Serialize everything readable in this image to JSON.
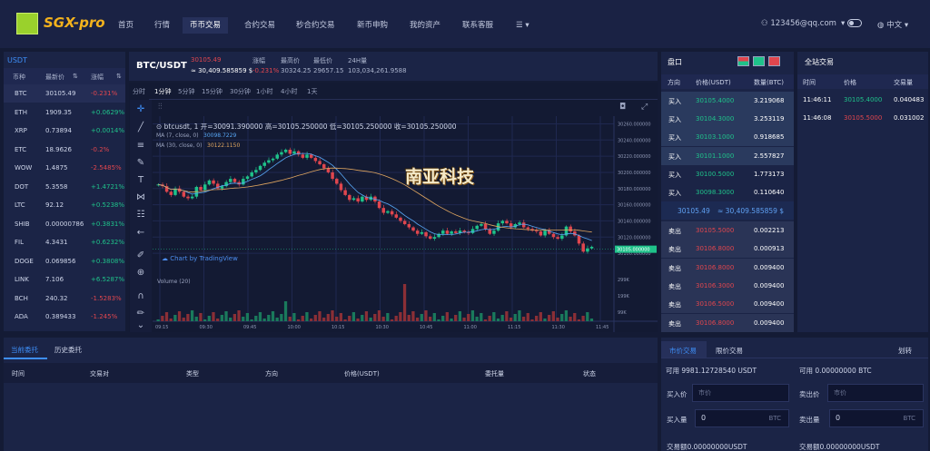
{
  "nav": {
    "logo_text": "SGX-pro",
    "items": [
      "首页",
      "行情",
      "币币交易",
      "合约交易",
      "秒合约交易",
      "新币申购",
      "我的资产",
      "联系客服",
      "☰ ▾"
    ],
    "active_index": 2,
    "user": "123456@qq.com",
    "lang": "中文"
  },
  "pairs": {
    "group": "USDT",
    "headers": [
      "币种",
      "最新价",
      "涨幅"
    ],
    "rows": [
      {
        "sym": "BTC",
        "price": "30105.49",
        "chg": "-0.231%",
        "dir": "down"
      },
      {
        "sym": "ETH",
        "price": "1909.35",
        "chg": "+0.0629%",
        "dir": "up"
      },
      {
        "sym": "XRP",
        "price": "0.73894",
        "chg": "+0.0014%",
        "dir": "up"
      },
      {
        "sym": "ETC",
        "price": "18.9626",
        "chg": "-0.2%",
        "dir": "down"
      },
      {
        "sym": "WOW",
        "price": "1.4875",
        "chg": "-2.5485%",
        "dir": "down"
      },
      {
        "sym": "DOT",
        "price": "5.3558",
        "chg": "+1.4721%",
        "dir": "up"
      },
      {
        "sym": "LTC",
        "price": "92.12",
        "chg": "+0.5238%",
        "dir": "up"
      },
      {
        "sym": "SHIB",
        "price": "0.00000786",
        "chg": "+0.3831%",
        "dir": "up"
      },
      {
        "sym": "FIL",
        "price": "4.3431",
        "chg": "+0.6232%",
        "dir": "up"
      },
      {
        "sym": "DOGE",
        "price": "0.069856",
        "chg": "+0.3808%",
        "dir": "up"
      },
      {
        "sym": "LINK",
        "price": "7.106",
        "chg": "+6.5287%",
        "dir": "up"
      },
      {
        "sym": "BCH",
        "price": "240.32",
        "chg": "-1.5283%",
        "dir": "down"
      },
      {
        "sym": "ADA",
        "price": "0.389433",
        "chg": "-1.245%",
        "dir": "down"
      }
    ]
  },
  "ticker": {
    "pair": "BTC/USDT",
    "price": "30105.49",
    "cny": "≈ 30,409.585859 $",
    "chg_label": "涨幅",
    "chg": "-0.231%",
    "high_label": "最高价",
    "high": "30324.25",
    "low_label": "最低价",
    "low": "29657.15",
    "vol_label": "24H量",
    "vol": "103,034,261.9588"
  },
  "chart": {
    "intervals": [
      "分时",
      "1分钟",
      "5分钟",
      "15分钟",
      "30分钟",
      "1小时",
      "4小时",
      "1天"
    ],
    "active_interval": 1,
    "ohlc_line": "btcusdt, 1  开=30091.390000  高=30105.250000  低=30105.250000  收=30105.250000",
    "ma7": "MA (7, close, 0)",
    "ma7_val": "30098.7229",
    "ma30": "MA (30, close, 0)",
    "ma30_val": "30122.1150",
    "volume_label": "Volume (20)",
    "brand": "Chart by TradingView",
    "watermark": "南亚科技",
    "y_ticks": [
      "30260.000000",
      "30240.000000",
      "30220.000000",
      "30200.000000",
      "30180.000000",
      "30160.000000",
      "30140.000000",
      "30120.000000",
      "30100.000000"
    ],
    "current_price": "30105.000000",
    "vol_ticks": [
      "299K",
      "199K",
      "99K"
    ],
    "x_ticks": [
      "09:15",
      "09:30",
      "09:45",
      "10:00",
      "10:15",
      "10:30",
      "10:45",
      "11:00",
      "11:15",
      "11:30",
      "11:45"
    ]
  },
  "chart_data": {
    "type": "candlestick",
    "y_range": [
      30090,
      30265
    ],
    "closes": [
      30185,
      30183,
      30176,
      30172,
      30180,
      30176,
      30170,
      30168,
      30170,
      30182,
      30178,
      30185,
      30190,
      30186,
      30180,
      30183,
      30188,
      30192,
      30188,
      30185,
      30192,
      30195,
      30200,
      30203,
      30208,
      30212,
      30215,
      30217,
      30222,
      30225,
      30228,
      30223,
      30226,
      30222,
      30218,
      30222,
      30218,
      30214,
      30210,
      30205,
      30200,
      30192,
      30186,
      30178,
      30172,
      30166,
      30168,
      30164,
      30170,
      30166,
      30170,
      30164,
      30156,
      30150,
      30152,
      30148,
      30144,
      30140,
      30136,
      30132,
      30128,
      30124,
      30126,
      30121,
      30118,
      30120,
      30124,
      30128,
      30124,
      30127,
      30125,
      30128,
      30126,
      30125,
      30130,
      30134,
      30136,
      30130,
      30124,
      30128,
      30137,
      30140,
      30137,
      30132,
      30136,
      30138,
      30132,
      30130,
      30128,
      30127,
      30122,
      30128,
      30124,
      30120,
      30118,
      30122,
      30133,
      30127,
      30122,
      30112,
      30102,
      30106,
      30108
    ]
  },
  "orderbook": {
    "title": "盘口",
    "headers": [
      "方向",
      "价格(USDT)",
      "数量(BTC)"
    ],
    "buys": [
      [
        "买入",
        "30105.4000",
        "3.219068"
      ],
      [
        "买入",
        "30104.3000",
        "3.253119"
      ],
      [
        "买入",
        "30103.1000",
        "0.918685"
      ],
      [
        "买入",
        "30101.1000",
        "2.557827"
      ],
      [
        "买入",
        "30100.5000",
        "1.773173"
      ],
      [
        "买入",
        "30098.3000",
        "0.110640"
      ]
    ],
    "mid_price": "30105.49",
    "mid_cny": "≈ 30,409.585859 $",
    "sells": [
      [
        "卖出",
        "30105.5000",
        "0.002213"
      ],
      [
        "卖出",
        "30106.8000",
        "0.000913"
      ],
      [
        "卖出",
        "30106.8000",
        "0.009400"
      ],
      [
        "卖出",
        "30106.3000",
        "0.009400"
      ],
      [
        "卖出",
        "30106.5000",
        "0.009400"
      ],
      [
        "卖出",
        "30106.8000",
        "0.009400"
      ]
    ]
  },
  "trades": {
    "title": "全站交易",
    "headers": [
      "时间",
      "价格",
      "交易量"
    ],
    "rows": [
      [
        "11:46:11",
        "30105.4000",
        "0.040483",
        "up"
      ],
      [
        "11:46:08",
        "30105.5000",
        "0.031002",
        "down"
      ]
    ]
  },
  "orders": {
    "tabs": [
      "当前委托",
      "历史委托"
    ],
    "headers": [
      "时间",
      "交易对",
      "类型",
      "方向",
      "价格(USDT)",
      "委托量",
      "状态"
    ]
  },
  "trade_form": {
    "tabs": [
      "市价交易",
      "限价交易"
    ],
    "leverage": "划转",
    "buy_avail": "可用 9981.12728540 USDT",
    "sell_avail": "可用 0.00000000 BTC",
    "buy_price_label": "买入价",
    "buy_price_ph": "市价",
    "sell_price_label": "卖出价",
    "sell_price_ph": "市价",
    "buy_qty_label": "买入量",
    "buy_qty": "0",
    "buy_unit": "BTC",
    "sell_qty_label": "卖出量",
    "sell_qty": "0",
    "sell_unit": "BTC",
    "buy_total": "交易额0.00000000USDT",
    "sell_total": "交易额0.00000000USDT"
  },
  "colors": {
    "up": "#1fc28a",
    "down": "#e0464e",
    "accent": "#3e8ef7",
    "bg": "#141b35"
  }
}
